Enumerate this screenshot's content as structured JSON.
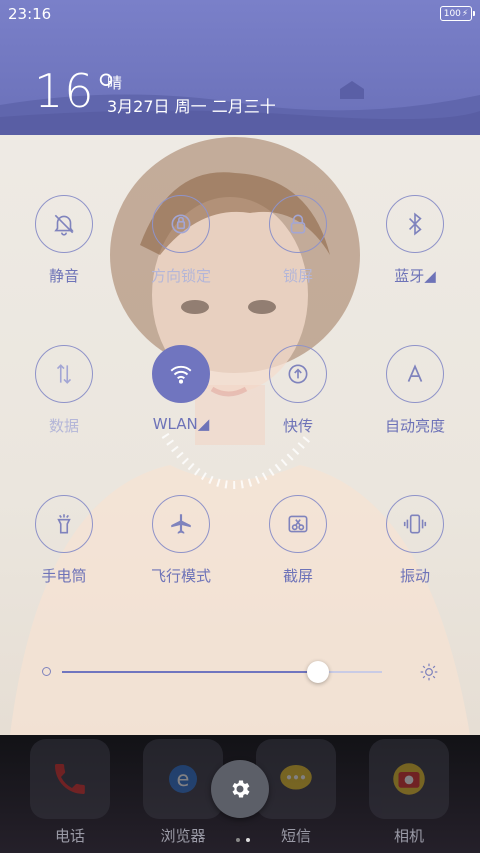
{
  "status": {
    "time": "23:16",
    "battery": "100"
  },
  "weather": {
    "temperature": "16°",
    "condition": "晴",
    "date": "3月27日 周一 二月三十"
  },
  "toggles": [
    {
      "label": "静音",
      "icon": "bell-off-icon",
      "active": false,
      "dim": false
    },
    {
      "label": "方向锁定",
      "icon": "rotation-lock-icon",
      "active": false,
      "dim": true
    },
    {
      "label": "锁屏",
      "icon": "lock-icon",
      "active": false,
      "dim": true
    },
    {
      "label": "蓝牙◢",
      "icon": "bluetooth-icon",
      "active": false,
      "dim": false
    },
    {
      "label": "数据",
      "icon": "data-arrows-icon",
      "active": false,
      "dim": true
    },
    {
      "label": "WLAN◢",
      "icon": "wifi-icon",
      "active": true,
      "dim": false
    },
    {
      "label": "快传",
      "icon": "upload-icon",
      "active": false,
      "dim": false
    },
    {
      "label": "自动亮度",
      "icon": "auto-brightness-icon",
      "active": false,
      "dim": false
    },
    {
      "label": "手电筒",
      "icon": "flashlight-icon",
      "active": false,
      "dim": false
    },
    {
      "label": "飞行模式",
      "icon": "airplane-icon",
      "active": false,
      "dim": false
    },
    {
      "label": "截屏",
      "icon": "screenshot-icon",
      "active": false,
      "dim": false
    },
    {
      "label": "振动",
      "icon": "vibrate-icon",
      "active": false,
      "dim": false
    }
  ],
  "brightness": {
    "level": 0.8
  },
  "dock": {
    "apps": [
      {
        "label": "电话",
        "icon": "phone-icon"
      },
      {
        "label": "浏览器",
        "icon": "browser-icon"
      },
      {
        "label": "短信",
        "icon": "message-icon"
      },
      {
        "label": "相机",
        "icon": "camera-icon"
      }
    ],
    "settings_icon": "gear-icon"
  },
  "colors": {
    "accent": "#7075bf",
    "header": "#6a70b8"
  }
}
